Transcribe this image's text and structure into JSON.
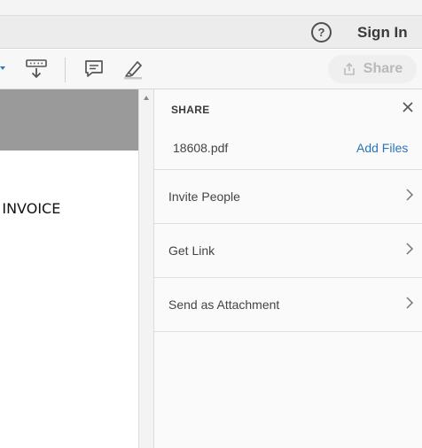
{
  "header": {
    "help_icon": "question-circle-icon",
    "help_glyph": "?",
    "signin_label": "Sign In"
  },
  "toolbar": {
    "tools": [
      "pin-download-icon",
      "comment-icon",
      "highlighter-icon"
    ],
    "share_label": "Share",
    "share_icon": "share-upload-icon",
    "accent_color": "#2b79c2"
  },
  "document": {
    "visible_text": "CE INVOICE"
  },
  "share_panel": {
    "title": "SHARE",
    "close_icon": "close-icon",
    "file_name": "18608.pdf",
    "add_files_label": "Add Files",
    "options": [
      {
        "label": "Invite People"
      },
      {
        "label": "Get Link"
      },
      {
        "label": "Send as Attachment"
      }
    ]
  }
}
